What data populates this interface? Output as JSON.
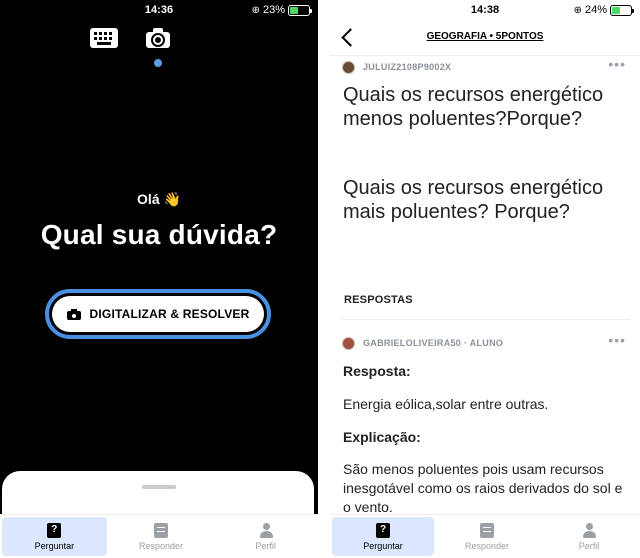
{
  "left": {
    "status": {
      "time": "14:36",
      "battery_pct": "23%",
      "battery_level": 0.23
    },
    "greeting": "Olá 👋",
    "headline": "Qual sua dúvida?",
    "scan_button": "DIGITALIZAR & RESOLVER",
    "tabs": [
      {
        "label": "Perguntar",
        "icon": "question-icon",
        "active": true
      },
      {
        "label": "Responder",
        "icon": "answer-icon",
        "active": false
      },
      {
        "label": "Perfil",
        "icon": "user-icon",
        "active": false
      }
    ]
  },
  "right": {
    "status": {
      "time": "14:38",
      "battery_pct": "24%",
      "battery_level": 0.24
    },
    "nav_title": "GEOGRAFIA • 5PONTOS",
    "question": {
      "author": "JULUIZ2108P9002X",
      "text_1": "Quais os recursos energético menos poluentes?Porque?",
      "text_2": "Quais os recursos energético mais poluentes? Porque?"
    },
    "answers_title": "RESPOSTAS",
    "answer": {
      "author": "GABRIELOLIVEIRA50 · ALUNO",
      "label_resposta": "Resposta:",
      "resposta": "Energia eólica,solar entre outras.",
      "label_explicacao": "Explicação:",
      "explicacao": "São menos poluentes pois usam recursos inesgotável como os raios derivados do sol e o vento."
    },
    "tabs": [
      {
        "label": "Perguntar",
        "icon": "question-icon",
        "active": true
      },
      {
        "label": "Responder",
        "icon": "answer-icon",
        "active": false
      },
      {
        "label": "Perfil",
        "icon": "user-icon",
        "active": false
      }
    ]
  },
  "colors": {
    "accent_blue": "#4a90e2",
    "tab_active_bg": "#dbe6ff",
    "muted": "#9aa0a6"
  }
}
